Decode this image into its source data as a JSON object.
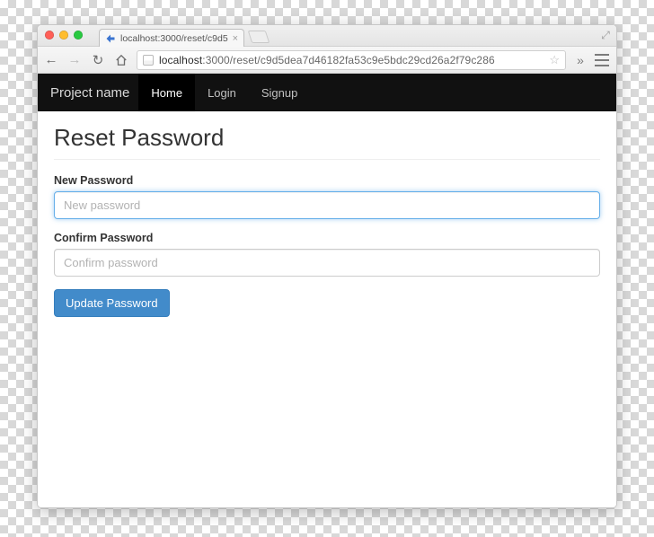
{
  "browser": {
    "tab_title": "localhost:3000/reset/c9d5",
    "url_host": "localhost",
    "url_path": ":3000/reset/c9d5dea7d46182fa53c9e5bdc29cd26a2f79c286"
  },
  "navbar": {
    "brand": "Project name",
    "links": [
      {
        "label": "Home",
        "active": true
      },
      {
        "label": "Login",
        "active": false
      },
      {
        "label": "Signup",
        "active": false
      }
    ]
  },
  "page": {
    "heading": "Reset Password",
    "new_password": {
      "label": "New Password",
      "placeholder": "New password"
    },
    "confirm_password": {
      "label": "Confirm Password",
      "placeholder": "Confirm password"
    },
    "submit_label": "Update Password"
  }
}
